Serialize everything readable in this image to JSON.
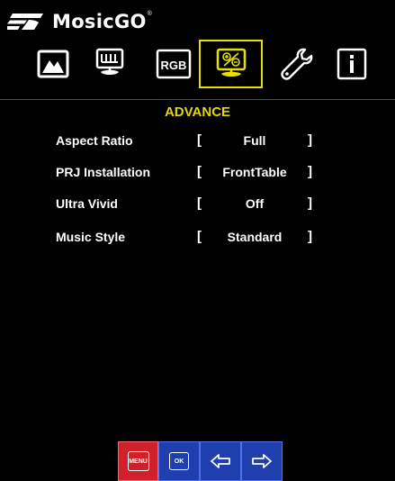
{
  "brand": {
    "name": "MosicGO",
    "registered": "®"
  },
  "tabs": [
    {
      "icon": "picture-icon",
      "active": false
    },
    {
      "icon": "display-icon",
      "active": false
    },
    {
      "icon": "rgb-icon",
      "label": "RGB",
      "active": false
    },
    {
      "icon": "advance-icon",
      "active": true
    },
    {
      "icon": "wrench-icon",
      "active": false
    },
    {
      "icon": "info-icon",
      "active": false
    }
  ],
  "colors": {
    "background": "#000000",
    "accent": "#e6d700",
    "menu_button": "#d0202a",
    "nav_button": "#1f3fae"
  },
  "section": {
    "title": "ADVANCE"
  },
  "settings": [
    {
      "label": "Aspect Ratio",
      "bracket_open": "[",
      "value": "Full",
      "bracket_close": "]"
    },
    {
      "label": "PRJ Installation",
      "bracket_open": "[",
      "value": "FrontTable",
      "bracket_close": "]"
    },
    {
      "label": "Ultra Vivid",
      "bracket_open": "[",
      "value": "Off",
      "bracket_close": "]"
    },
    {
      "label": "Music Style",
      "bracket_open": "[",
      "value": "Standard",
      "bracket_close": "]"
    }
  ],
  "controls": {
    "menu_label": "MENU",
    "ok_label": "OK",
    "left_icon": "arrow-left-icon",
    "right_icon": "arrow-right-icon"
  }
}
